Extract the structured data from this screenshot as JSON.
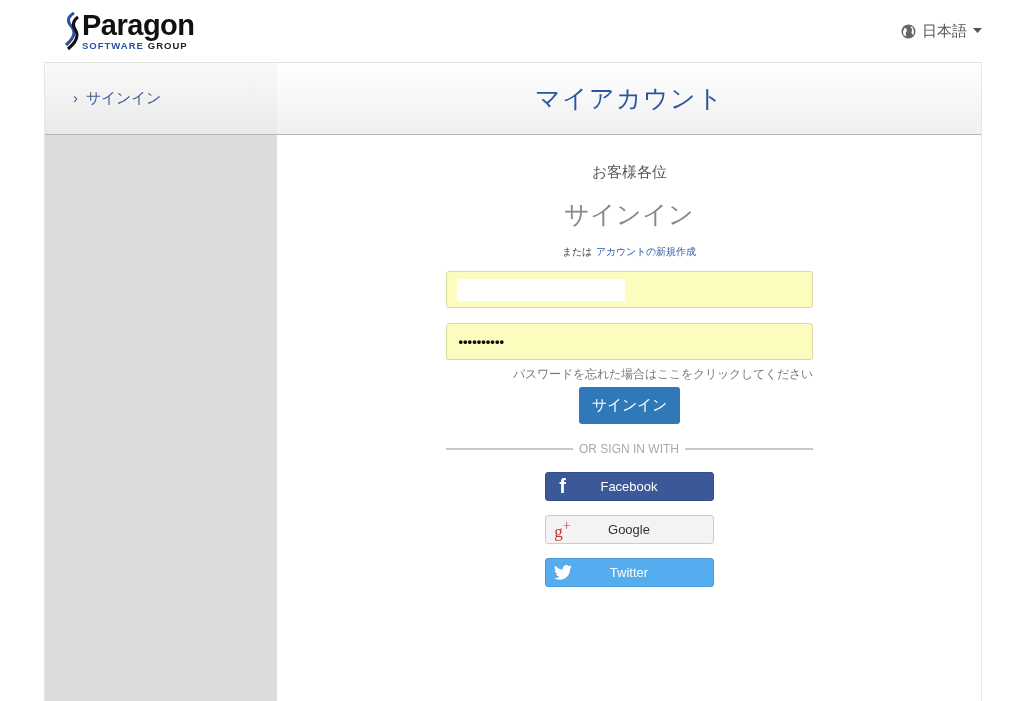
{
  "logo": {
    "name": "Paragon",
    "tagline_1": "SOFTWARE",
    "tagline_2": "GROUP"
  },
  "language": {
    "label": "日本語"
  },
  "sidebar": {
    "items": [
      {
        "marker": "›",
        "label": "サインイン",
        "selected": true
      }
    ]
  },
  "page_title": "マイアカウント",
  "greeting": "お客様各位",
  "form_title": "サインイン",
  "register": {
    "prefix": "または",
    "link": "アカウントの新規作成"
  },
  "fields": [
    {
      "kind": "email",
      "redacted": true
    },
    {
      "kind": "password",
      "value": "••••••••••",
      "redacted": false
    }
  ],
  "forgot_link": "パスワードを忘れた場合はここをクリックしてください",
  "submit": "サインイン",
  "divider": "OR SIGN IN WITH",
  "social": [
    {
      "kind": "facebook",
      "icon": "f",
      "label": "Facebook"
    },
    {
      "kind": "google",
      "icon": "g$^{+}$",
      "label": "Google"
    },
    {
      "kind": "twitter",
      "label": "Twitter"
    }
  ]
}
